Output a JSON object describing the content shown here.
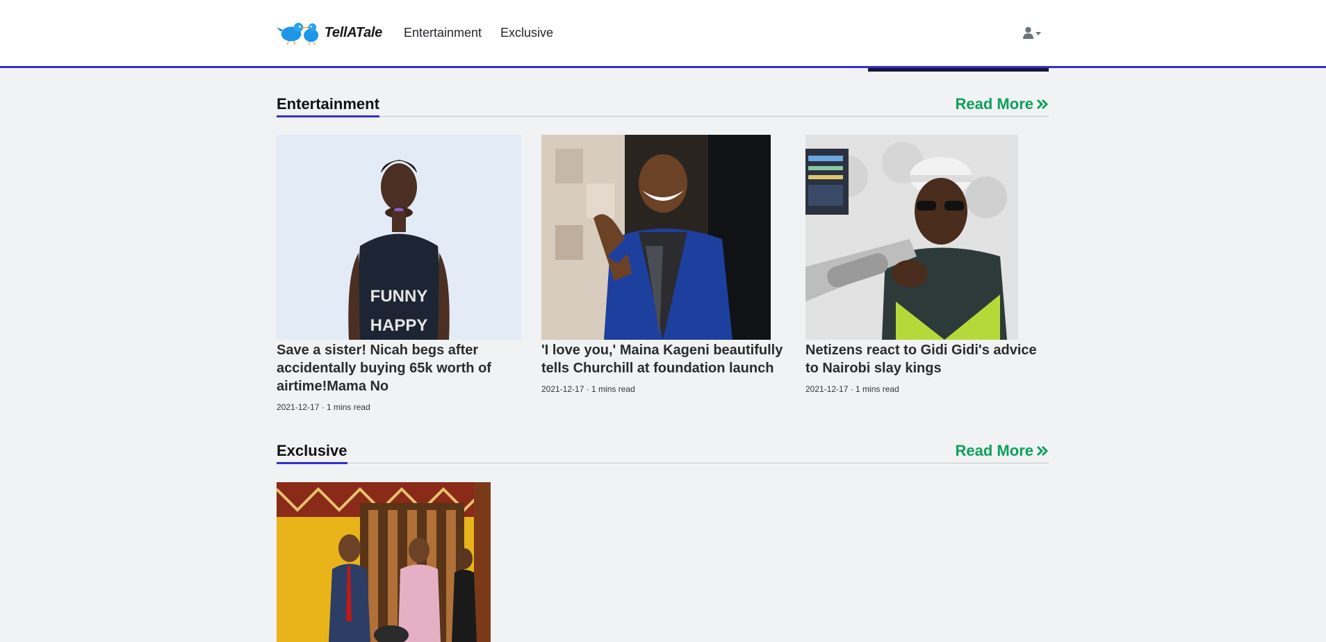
{
  "brand": {
    "name": "TellATale"
  },
  "nav": {
    "links": [
      "Entertainment",
      "Exclusive"
    ],
    "user_icon": "user-icon"
  },
  "sections": {
    "entertainment": {
      "title": "Entertainment",
      "read_more": "Read More",
      "cards": [
        {
          "title": "Save a sister! Nicah begs after accidentally buying 65k worth of airtime!Mama No",
          "meta": "2021-12-17 · 1 mins read",
          "image": "photo of woman in black FUNNY HAPPY tank top"
        },
        {
          "title": "'I love you,' Maina Kageni beautifully tells Churchill at foundation launch",
          "meta": "2021-12-17 · 1 mins read",
          "image": "photo of smiling man in blue jacket pointing"
        },
        {
          "title": "Netizens react to Gidi Gidi's advice to Nairobi slay kings",
          "meta": "2021-12-17 · 1 mins read",
          "image": "photo of man in cap and glasses at microphone"
        }
      ]
    },
    "exclusive": {
      "title": "Exclusive",
      "read_more": "Read More",
      "cards": [
        {
          "image": "photo of men in suits at event"
        }
      ]
    }
  },
  "colors": {
    "accent": "#2f2fd0",
    "read_more": "#0d9f5c",
    "background": "#f0f2f3"
  }
}
